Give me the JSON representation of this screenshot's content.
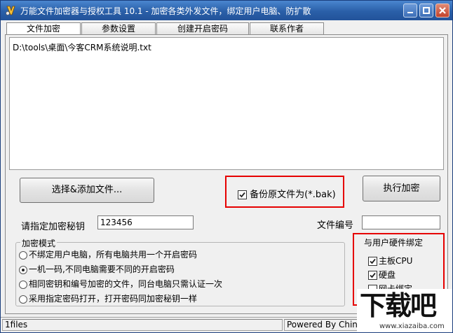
{
  "window": {
    "title": "万能文件加密器与授权工具 10.1 - 加密各类外发文件，绑定用户电脑、防扩散",
    "icon": "app-logo-icon"
  },
  "tabs": [
    {
      "label": "文件加密",
      "active": true
    },
    {
      "label": "参数设置",
      "active": false
    },
    {
      "label": "创建开启密码",
      "active": false
    },
    {
      "label": "联系作者",
      "active": false
    }
  ],
  "file_list": {
    "items": [
      "D:\\tools\\桌面\\今客CRM系统说明.txt"
    ]
  },
  "buttons": {
    "select_add_files": "选择&添加文件...",
    "execute_encrypt": "执行加密"
  },
  "backup": {
    "label": "备份原文件为(*.bak)",
    "checked": true
  },
  "key_field": {
    "label": "请指定加密秘钥",
    "value": "123456"
  },
  "file_number": {
    "label": "文件编号",
    "value": ""
  },
  "encrypt_mode": {
    "title": "加密模式",
    "options": [
      {
        "label": "不绑定用户电脑，所有电脑共用一个开启密码",
        "selected": false
      },
      {
        "label": "一机一码,不同电脑需要不同的开启密码",
        "selected": true
      },
      {
        "label": "相同密钥和编号加密的文件，同台电脑只需认证一次",
        "selected": false
      },
      {
        "label": "采用指定密码打开，打开密码同加密秘钥一样",
        "selected": false
      }
    ]
  },
  "hardware_binding": {
    "title": "与用户硬件绑定",
    "options": [
      {
        "label": "主板CPU",
        "checked": true
      },
      {
        "label": "硬盘",
        "checked": true
      },
      {
        "label": "网卡绑定",
        "checked": false
      }
    ]
  },
  "status": {
    "left": "1files",
    "right": "Powered By China"
  },
  "watermark": {
    "text": "下载吧",
    "url": "www.xiazaiba.com"
  },
  "colors": {
    "highlight": "#e60000",
    "titlebar": "#2a5fa8"
  }
}
